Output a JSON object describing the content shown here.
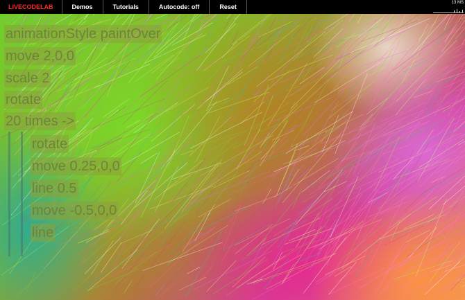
{
  "nav": {
    "brand": "LIVECODELAB",
    "demos": "Demos",
    "tutorials": "Tutorials",
    "autocode": "Autocode: off",
    "reset": "Reset"
  },
  "stats": {
    "label": "13 MS"
  },
  "editor": {
    "lines": [
      "animationStyle paintOver",
      "move 2,0,0",
      "scale 2",
      "rotate",
      "20 times ->",
      "rotate",
      "move 0.25,0,0",
      "line 0.5",
      "move -0.5,0,0",
      "line"
    ]
  },
  "colors": {
    "brand": "#ff2a2a",
    "topbar": "#000000",
    "code_text": "#6e7d3c",
    "code_highlight": "#8ca03c"
  }
}
